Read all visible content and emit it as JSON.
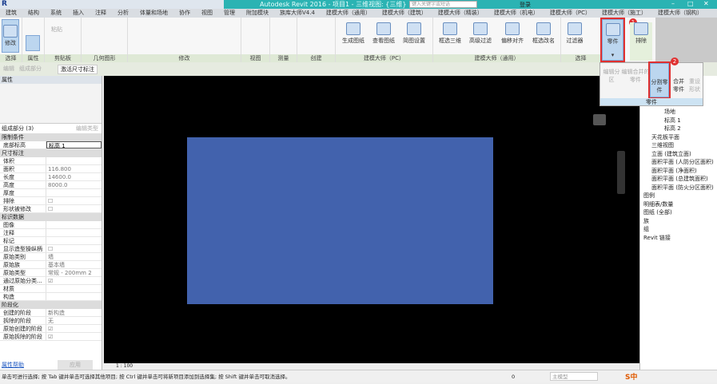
{
  "window": {
    "title": "Autodesk Revit 2016 -    项目1 - 三维视图: {三维}",
    "search_placeholder": "键入关键字或短语",
    "login": "登录"
  },
  "tabs": [
    "建筑",
    "结构",
    "系统",
    "插入",
    "注释",
    "分析",
    "体量和场地",
    "协作",
    "视图",
    "管理",
    "附加模块",
    "族库大师V4.4",
    "建模大师（通用）",
    "建模大师（建筑）",
    "建模大师（精装）",
    "建模大师（机电）",
    "建模大师（PC）",
    "建模大师（施工）",
    "建模大师（钢构）"
  ],
  "ribbon": {
    "modify": "修改",
    "paste": "粘贴",
    "panels": [
      "选择",
      "属性",
      "剪贴板",
      "几何图形",
      "修改",
      "视图",
      "测量",
      "创建",
      "建模大师（PC）",
      "建模大师（通用）",
      "选择"
    ],
    "pc_buttons": [
      "生成图纸",
      "查看图纸",
      "简图设置"
    ],
    "general_buttons": [
      "框选三维",
      "高级过滤",
      "偏移对齐",
      "框选改名"
    ],
    "filter": "过滤器",
    "parts": "零件",
    "exclude": "排除",
    "badge1": "1",
    "badge2": "2"
  },
  "dropdown": {
    "items": [
      "编辑分区",
      "编辑合并的零件",
      "分割零件",
      "合并零件",
      "重设形状"
    ],
    "label": "零件"
  },
  "optionsbar": {
    "items": [
      "编辑",
      "组成部分"
    ],
    "active": "激活尺寸标注"
  },
  "properties": {
    "title": "属性",
    "type": "组成部分 (3)",
    "edit_type": "编辑类型",
    "groups": [
      {
        "name": "限制条件",
        "rows": [
          {
            "k": "底部标高",
            "v": "标高 1"
          }
        ]
      },
      {
        "name": "尺寸标注",
        "rows": [
          {
            "k": "体积",
            "v": ""
          },
          {
            "k": "面积",
            "v": "116.800"
          },
          {
            "k": "长度",
            "v": "14600.0"
          },
          {
            "k": "高度",
            "v": "8000.0"
          },
          {
            "k": "厚度",
            "v": ""
          },
          {
            "k": "排除",
            "v": "☐"
          },
          {
            "k": "形状被修改",
            "v": "☐"
          }
        ]
      },
      {
        "name": "标识数据",
        "rows": [
          {
            "k": "图像",
            "v": ""
          },
          {
            "k": "注释",
            "v": ""
          },
          {
            "k": "标记",
            "v": ""
          },
          {
            "k": "显示造型操纵柄",
            "v": "☐"
          },
          {
            "k": "原始类别",
            "v": "墙"
          },
          {
            "k": "原始族",
            "v": "基本墙"
          },
          {
            "k": "原始类型",
            "v": "常规 - 200mm 2"
          },
          {
            "k": "通过原始分类...",
            "v": "☑"
          },
          {
            "k": "材质",
            "v": ""
          },
          {
            "k": "构造",
            "v": ""
          }
        ]
      },
      {
        "name": "阶段化",
        "rows": [
          {
            "k": "创建的阶段",
            "v": "新构造"
          },
          {
            "k": "拆除的阶段",
            "v": "无"
          },
          {
            "k": "原始创建的阶段",
            "v": "☑"
          },
          {
            "k": "原始拆除的阶段",
            "v": "☑"
          }
        ]
      }
    ],
    "help": "属性帮助",
    "apply": "应用"
  },
  "viewbar": {
    "scale": "1 : 100"
  },
  "browser": {
    "items": [
      "场地",
      "标高 1",
      "标高 2",
      "天花板平面",
      "三维视图",
      "立面 (建筑立面)",
      "面积平面 (人防分区面积)",
      "面积平面 (净面积)",
      "面积平面 (总建筑面积)",
      "面积平面 (防火分区面积)",
      "图例",
      "明细表/数量",
      "图纸 (全部)",
      "族",
      "组",
      "Revit 链接"
    ]
  },
  "status": {
    "text": "单击可进行选择; 按 Tab 键并单击可选择其他项目; 按 Ctrl 键并单击可将新项目添加到选择集; 按 Shift 键并单击可取消选择。",
    "value": "0",
    "model": "主模型"
  },
  "colors": {
    "part": "#4262ad",
    "canvas": "#000000",
    "highlight": "#e03030"
  }
}
